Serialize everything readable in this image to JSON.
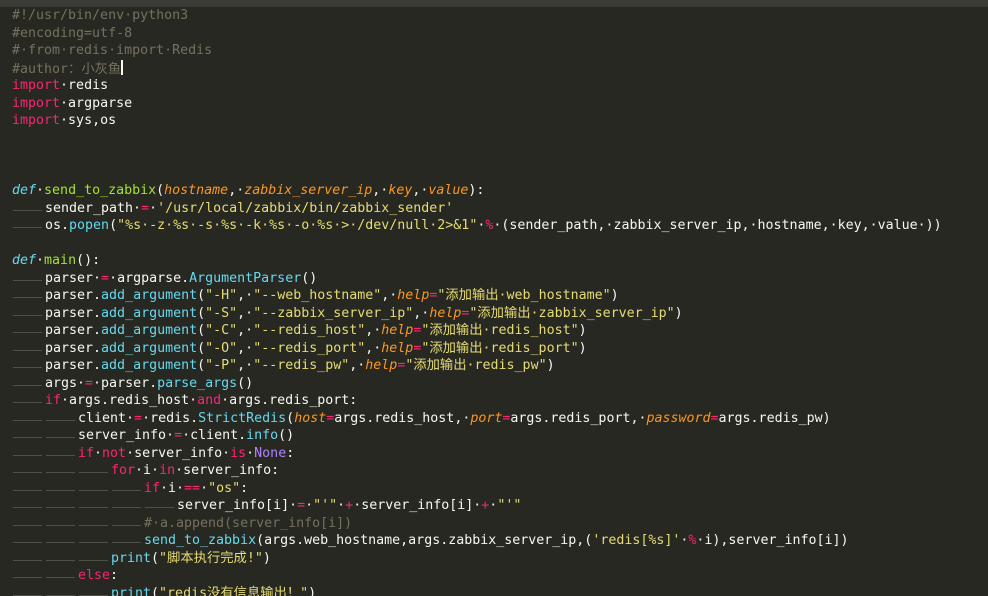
{
  "editor": {
    "theme": {
      "background": "#272822",
      "foreground": "#F8F8F2"
    },
    "code_lines": [
      {
        "indent": 0,
        "tokens": [
          {
            "t": "#!/usr/bin/env·python3",
            "c": "comment"
          }
        ]
      },
      {
        "indent": 0,
        "tokens": [
          {
            "t": "#encoding=utf-8",
            "c": "comment"
          }
        ]
      },
      {
        "indent": 0,
        "tokens": [
          {
            "t": "#·from·redis·import·Redis",
            "c": "comment"
          }
        ]
      },
      {
        "indent": 0,
        "tokens": [
          {
            "t": "#author：小灰鱼",
            "c": "comment"
          }
        ],
        "cursor": true
      },
      {
        "indent": 0,
        "tokens": [
          {
            "t": "import",
            "c": "kw"
          },
          {
            "t": "·redis",
            "c": "plain"
          }
        ]
      },
      {
        "indent": 0,
        "tokens": [
          {
            "t": "import",
            "c": "kw"
          },
          {
            "t": "·argparse",
            "c": "plain"
          }
        ]
      },
      {
        "indent": 0,
        "tokens": [
          {
            "t": "import",
            "c": "kw"
          },
          {
            "t": "·sys,os",
            "c": "plain"
          }
        ]
      },
      {
        "indent": 0,
        "tokens": []
      },
      {
        "indent": 0,
        "tokens": []
      },
      {
        "indent": 0,
        "tokens": []
      },
      {
        "indent": 0,
        "tokens": [
          {
            "t": "def",
            "c": "def"
          },
          {
            "t": "·",
            "c": "plain"
          },
          {
            "t": "send_to_zabbix",
            "c": "fn"
          },
          {
            "t": "(",
            "c": "plain"
          },
          {
            "t": "hostname",
            "c": "param"
          },
          {
            "t": ",·",
            "c": "plain"
          },
          {
            "t": "zabbix_server_ip",
            "c": "param"
          },
          {
            "t": ",·",
            "c": "plain"
          },
          {
            "t": "key",
            "c": "param"
          },
          {
            "t": ",·",
            "c": "plain"
          },
          {
            "t": "value",
            "c": "param"
          },
          {
            "t": "):",
            "c": "plain"
          }
        ]
      },
      {
        "indent": 1,
        "tokens": [
          {
            "t": "sender_path·",
            "c": "plain"
          },
          {
            "t": "=",
            "c": "kw"
          },
          {
            "t": "·",
            "c": "plain"
          },
          {
            "t": "'/usr/local/zabbix/bin/zabbix_sender'",
            "c": "str"
          }
        ]
      },
      {
        "indent": 1,
        "tokens": [
          {
            "t": "os.",
            "c": "plain"
          },
          {
            "t": "popen",
            "c": "builtin"
          },
          {
            "t": "(",
            "c": "plain"
          },
          {
            "t": "\"%s·-z·%s·-s·%s·-k·%s·-o·%s·>·/dev/null·2>&1\"",
            "c": "str"
          },
          {
            "t": "·",
            "c": "plain"
          },
          {
            "t": "%",
            "c": "kw"
          },
          {
            "t": "·(sender_path,·zabbix_server_ip,·hostname,·key,·value·))",
            "c": "plain"
          }
        ]
      },
      {
        "indent": 0,
        "tokens": []
      },
      {
        "indent": 0,
        "tokens": [
          {
            "t": "def",
            "c": "def"
          },
          {
            "t": "·",
            "c": "plain"
          },
          {
            "t": "main",
            "c": "fn"
          },
          {
            "t": "():",
            "c": "plain"
          }
        ]
      },
      {
        "indent": 1,
        "tokens": [
          {
            "t": "parser·",
            "c": "plain"
          },
          {
            "t": "=",
            "c": "kw"
          },
          {
            "t": "·argparse.",
            "c": "plain"
          },
          {
            "t": "ArgumentParser",
            "c": "builtin"
          },
          {
            "t": "()",
            "c": "plain"
          }
        ]
      },
      {
        "indent": 1,
        "tokens": [
          {
            "t": "parser.",
            "c": "plain"
          },
          {
            "t": "add_argument",
            "c": "builtin"
          },
          {
            "t": "(",
            "c": "plain"
          },
          {
            "t": "\"-H\"",
            "c": "str"
          },
          {
            "t": ",·",
            "c": "plain"
          },
          {
            "t": "\"--web_hostname\"",
            "c": "str"
          },
          {
            "t": ",·",
            "c": "plain"
          },
          {
            "t": "help",
            "c": "param"
          },
          {
            "t": "=",
            "c": "kw"
          },
          {
            "t": "\"添加输出·web_hostname\"",
            "c": "str"
          },
          {
            "t": ")",
            "c": "plain"
          }
        ]
      },
      {
        "indent": 1,
        "tokens": [
          {
            "t": "parser.",
            "c": "plain"
          },
          {
            "t": "add_argument",
            "c": "builtin"
          },
          {
            "t": "(",
            "c": "plain"
          },
          {
            "t": "\"-S\"",
            "c": "str"
          },
          {
            "t": ",·",
            "c": "plain"
          },
          {
            "t": "\"--zabbix_server_ip\"",
            "c": "str"
          },
          {
            "t": ",·",
            "c": "plain"
          },
          {
            "t": "help",
            "c": "param"
          },
          {
            "t": "=",
            "c": "kw"
          },
          {
            "t": "\"添加输出·zabbix_server_ip\"",
            "c": "str"
          },
          {
            "t": ")",
            "c": "plain"
          }
        ]
      },
      {
        "indent": 1,
        "tokens": [
          {
            "t": "parser.",
            "c": "plain"
          },
          {
            "t": "add_argument",
            "c": "builtin"
          },
          {
            "t": "(",
            "c": "plain"
          },
          {
            "t": "\"-C\"",
            "c": "str"
          },
          {
            "t": ",·",
            "c": "plain"
          },
          {
            "t": "\"--redis_host\"",
            "c": "str"
          },
          {
            "t": ",·",
            "c": "plain"
          },
          {
            "t": "help",
            "c": "param"
          },
          {
            "t": "=",
            "c": "kw"
          },
          {
            "t": "\"添加输出·redis_host\"",
            "c": "str"
          },
          {
            "t": ")",
            "c": "plain"
          }
        ]
      },
      {
        "indent": 1,
        "tokens": [
          {
            "t": "parser.",
            "c": "plain"
          },
          {
            "t": "add_argument",
            "c": "builtin"
          },
          {
            "t": "(",
            "c": "plain"
          },
          {
            "t": "\"-O\"",
            "c": "str"
          },
          {
            "t": ",·",
            "c": "plain"
          },
          {
            "t": "\"--redis_port\"",
            "c": "str"
          },
          {
            "t": ",·",
            "c": "plain"
          },
          {
            "t": "help",
            "c": "param"
          },
          {
            "t": "=",
            "c": "kw"
          },
          {
            "t": "\"添加输出·redis_port\"",
            "c": "str"
          },
          {
            "t": ")",
            "c": "plain"
          }
        ]
      },
      {
        "indent": 1,
        "tokens": [
          {
            "t": "parser.",
            "c": "plain"
          },
          {
            "t": "add_argument",
            "c": "builtin"
          },
          {
            "t": "(",
            "c": "plain"
          },
          {
            "t": "\"-P\"",
            "c": "str"
          },
          {
            "t": ",·",
            "c": "plain"
          },
          {
            "t": "\"--redis_pw\"",
            "c": "str"
          },
          {
            "t": ",·",
            "c": "plain"
          },
          {
            "t": "help",
            "c": "param"
          },
          {
            "t": "=",
            "c": "kw"
          },
          {
            "t": "\"添加输出·redis_pw\"",
            "c": "str"
          },
          {
            "t": ")",
            "c": "plain"
          }
        ]
      },
      {
        "indent": 1,
        "tokens": [
          {
            "t": "args·",
            "c": "plain"
          },
          {
            "t": "=",
            "c": "kw"
          },
          {
            "t": "·parser.",
            "c": "plain"
          },
          {
            "t": "parse_args",
            "c": "builtin"
          },
          {
            "t": "()",
            "c": "plain"
          }
        ]
      },
      {
        "indent": 1,
        "tokens": [
          {
            "t": "if",
            "c": "kw"
          },
          {
            "t": "·args.redis_host·",
            "c": "plain"
          },
          {
            "t": "and",
            "c": "kw"
          },
          {
            "t": "·args.redis_port:",
            "c": "plain"
          }
        ]
      },
      {
        "indent": 2,
        "tokens": [
          {
            "t": "client·",
            "c": "plain"
          },
          {
            "t": "=",
            "c": "kw"
          },
          {
            "t": "·redis.",
            "c": "plain"
          },
          {
            "t": "StrictRedis",
            "c": "builtin"
          },
          {
            "t": "(",
            "c": "plain"
          },
          {
            "t": "host",
            "c": "param"
          },
          {
            "t": "=",
            "c": "kw"
          },
          {
            "t": "args.redis_host,·",
            "c": "plain"
          },
          {
            "t": "port",
            "c": "param"
          },
          {
            "t": "=",
            "c": "kw"
          },
          {
            "t": "args.redis_port,·",
            "c": "plain"
          },
          {
            "t": "password",
            "c": "param"
          },
          {
            "t": "=",
            "c": "kw"
          },
          {
            "t": "args.redis_pw)",
            "c": "plain"
          }
        ]
      },
      {
        "indent": 2,
        "tokens": [
          {
            "t": "server_info·",
            "c": "plain"
          },
          {
            "t": "=",
            "c": "kw"
          },
          {
            "t": "·client.",
            "c": "plain"
          },
          {
            "t": "info",
            "c": "builtin"
          },
          {
            "t": "()",
            "c": "plain"
          }
        ]
      },
      {
        "indent": 2,
        "tokens": [
          {
            "t": "if",
            "c": "kw"
          },
          {
            "t": "·",
            "c": "plain"
          },
          {
            "t": "not",
            "c": "kw"
          },
          {
            "t": "·server_info·",
            "c": "plain"
          },
          {
            "t": "is",
            "c": "kw"
          },
          {
            "t": "·",
            "c": "plain"
          },
          {
            "t": "None",
            "c": "const"
          },
          {
            "t": ":",
            "c": "plain"
          }
        ]
      },
      {
        "indent": 3,
        "tokens": [
          {
            "t": "for",
            "c": "kw"
          },
          {
            "t": "·i·",
            "c": "plain"
          },
          {
            "t": "in",
            "c": "kw"
          },
          {
            "t": "·server_info:",
            "c": "plain"
          }
        ]
      },
      {
        "indent": 4,
        "tokens": [
          {
            "t": "if",
            "c": "kw"
          },
          {
            "t": "·i·",
            "c": "plain"
          },
          {
            "t": "==",
            "c": "kw"
          },
          {
            "t": "·",
            "c": "plain"
          },
          {
            "t": "\"os\"",
            "c": "str"
          },
          {
            "t": ":",
            "c": "plain"
          }
        ]
      },
      {
        "indent": 5,
        "tokens": [
          {
            "t": "server_info[i]·",
            "c": "plain"
          },
          {
            "t": "=",
            "c": "kw"
          },
          {
            "t": "·",
            "c": "plain"
          },
          {
            "t": "\"'\"",
            "c": "str"
          },
          {
            "t": "·",
            "c": "plain"
          },
          {
            "t": "+",
            "c": "kw"
          },
          {
            "t": "·server_info[i]·",
            "c": "plain"
          },
          {
            "t": "+",
            "c": "kw"
          },
          {
            "t": "·",
            "c": "plain"
          },
          {
            "t": "\"'\"",
            "c": "str"
          }
        ]
      },
      {
        "indent": 4,
        "tokens": [
          {
            "t": "#·a.append(server_info[i])",
            "c": "comment"
          }
        ]
      },
      {
        "indent": 4,
        "tokens": [
          {
            "t": "send_to_zabbix",
            "c": "builtin"
          },
          {
            "t": "(args.web_hostname,args.zabbix_server_ip,(",
            "c": "plain"
          },
          {
            "t": "'redis[%s]'",
            "c": "str"
          },
          {
            "t": "·",
            "c": "plain"
          },
          {
            "t": "%",
            "c": "kw"
          },
          {
            "t": "·i),server_info[i])",
            "c": "plain"
          }
        ]
      },
      {
        "indent": 3,
        "tokens": [
          {
            "t": "print",
            "c": "builtin"
          },
          {
            "t": "(",
            "c": "plain"
          },
          {
            "t": "\"脚本执行完成!\"",
            "c": "str"
          },
          {
            "t": ")",
            "c": "plain"
          }
        ]
      },
      {
        "indent": 2,
        "tokens": [
          {
            "t": "else",
            "c": "kw"
          },
          {
            "t": ":",
            "c": "plain"
          }
        ]
      },
      {
        "indent": 3,
        "tokens": [
          {
            "t": "print",
            "c": "builtin"
          },
          {
            "t": "(",
            "c": "plain"
          },
          {
            "t": "\"redis没有信息输出！\"",
            "c": "str"
          },
          {
            "t": ")",
            "c": "plain"
          }
        ]
      }
    ]
  }
}
